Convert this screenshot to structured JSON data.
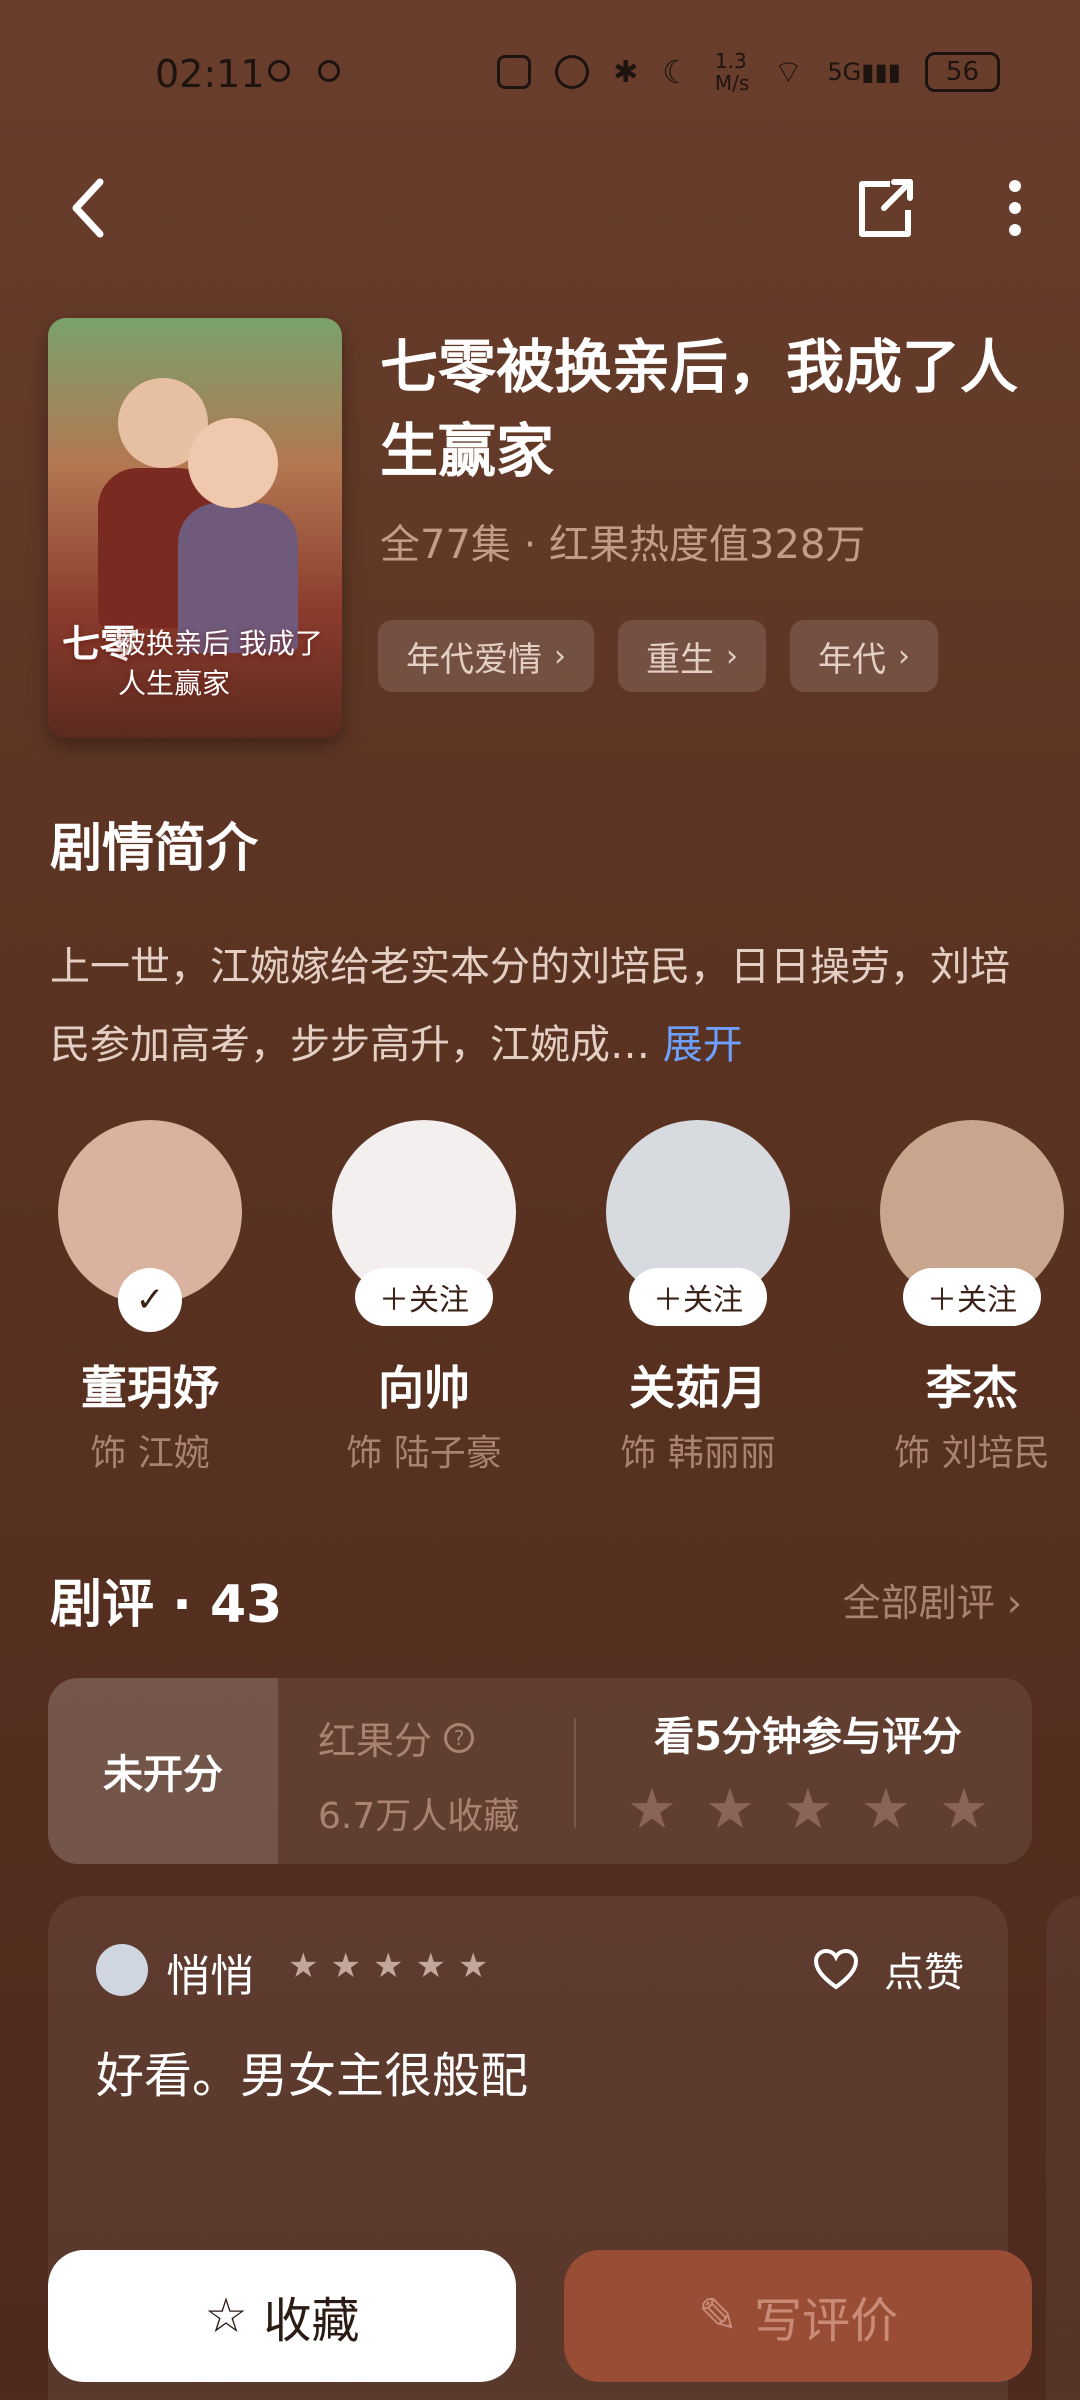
{
  "status_bar": {
    "time": "02:11",
    "net_speed": "1.3\nM/s",
    "signal": "5G",
    "battery": "56"
  },
  "drama": {
    "title": "七零被换亲后，我成了人生赢家",
    "meta": "全77集 · 红果热度值328万",
    "tags": [
      {
        "label": "年代爱情"
      },
      {
        "label": "重生"
      },
      {
        "label": "年代"
      }
    ],
    "poster_title": "七零",
    "poster_subtitle": "被换亲后 我成了人生赢家"
  },
  "synopsis": {
    "heading": "剧情简介",
    "text": "上一世，江婉嫁给老实本分的刘培民，日日操劳，刘培民参加高考，步步高升，江婉成…",
    "expand_label": "展开"
  },
  "cast": [
    {
      "name": "董玥妤",
      "role": "饰 江婉",
      "followed": true,
      "follow_label": "✓",
      "avatar_color": "#d9b3a0"
    },
    {
      "name": "向帅",
      "role": "饰 陆子豪",
      "followed": false,
      "follow_label": "＋关注",
      "avatar_color": "#f2efee"
    },
    {
      "name": "关茹月",
      "role": "饰 韩丽丽",
      "followed": false,
      "follow_label": "＋关注",
      "avatar_color": "#d7dbe0"
    },
    {
      "name": "李杰",
      "role": "饰 刘培民",
      "followed": false,
      "follow_label": "＋关注",
      "avatar_color": "#c9a58e"
    }
  ],
  "reviews": {
    "heading": "剧评 · 43",
    "all_label": "全部剧评",
    "score_label": "未开分",
    "hongguo_label": "红果分",
    "collections": "6.7万人收藏",
    "prompt": "看5分钟参与评分",
    "items": [
      {
        "user": "悄悄",
        "stars": 5,
        "text": "好看。男女主很般配",
        "like_label": "点赞"
      }
    ]
  },
  "actions": {
    "collect": "收藏",
    "write_review": "写评价"
  }
}
